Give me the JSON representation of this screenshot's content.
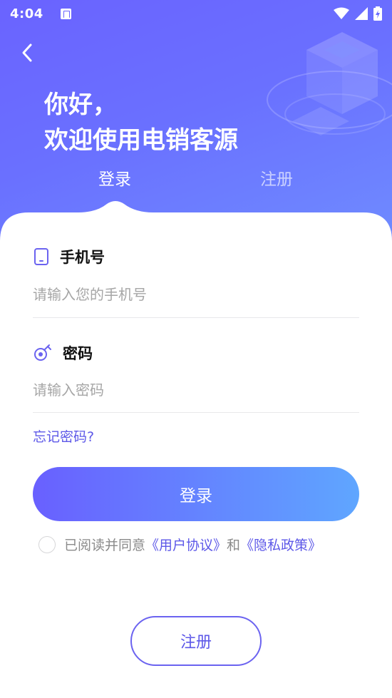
{
  "status_bar": {
    "time": "4:04",
    "notification_icon": "app-notification-icon",
    "icons": [
      "wifi-icon",
      "signal-icon",
      "battery-charging-icon"
    ]
  },
  "header": {
    "back_icon": "chevron-left-icon",
    "greeting_line1": "你好，",
    "greeting_line2": "欢迎使用电销客源"
  },
  "tabs": [
    {
      "label": "登录",
      "active": true
    },
    {
      "label": "注册",
      "active": false
    }
  ],
  "form": {
    "phone": {
      "icon": "phone-icon",
      "label": "手机号",
      "placeholder": "请输入您的手机号",
      "value": ""
    },
    "password": {
      "icon": "key-icon",
      "label": "密码",
      "placeholder": "请输入密码",
      "value": ""
    },
    "forgot_label": "忘记密码?",
    "login_label": "登录"
  },
  "agreement": {
    "checked": false,
    "prefix": "已阅读并同意",
    "user_agreement": "《用户协议》",
    "and": "和",
    "privacy_policy": "《隐私政策》"
  },
  "register_label": "注册",
  "colors": {
    "header_start": "#6a63ff",
    "header_end": "#6f8dff",
    "accent": "#5d58e8",
    "button_start": "#6960ff",
    "button_end": "#5fa6ff"
  }
}
